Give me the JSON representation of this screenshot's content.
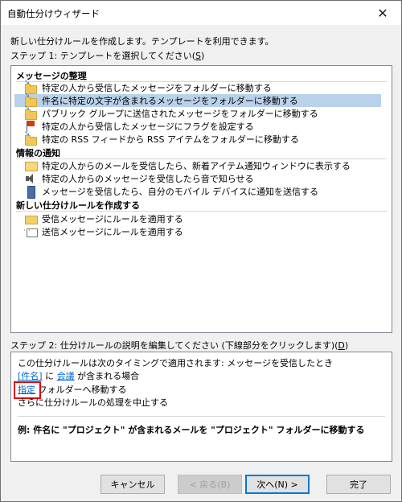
{
  "window": {
    "title": "自動仕分けウィザード",
    "close_glyph": "✕"
  },
  "intro_text": "新しい仕分けルールを作成します。テンプレートを利用できます。",
  "step1": {
    "label_prefix": "ステップ 1: テンプレートを選択してください(",
    "label_key": "S",
    "label_suffix": ")"
  },
  "groups": [
    {
      "header": "メッセージの整理",
      "items": [
        {
          "label": "特定の人から受信したメッセージをフォルダーに移動する",
          "icon": "folder-move-icon",
          "selected": false
        },
        {
          "label": "件名に特定の文字が含まれるメッセージをフォルダーに移動する",
          "icon": "folder-move-icon",
          "selected": true
        },
        {
          "label": "パブリック グループに送信されたメッセージをフォルダーに移動する",
          "icon": "folder-move-icon",
          "selected": false
        },
        {
          "label": "特定の人から受信したメッセージにフラグを設定する",
          "icon": "flag-icon",
          "selected": false
        },
        {
          "label": "特定の RSS フィードから RSS アイテムをフォルダーに移動する",
          "icon": "folder-move-icon",
          "selected": false
        }
      ]
    },
    {
      "header": "情報の通知",
      "items": [
        {
          "label": "特定の人からのメールを受信したら、新着アイテム通知ウィンドウに表示する",
          "icon": "new-mail-alert-icon",
          "selected": false
        },
        {
          "label": "特定の人からのメッセージを受信したら音で知らせる",
          "icon": "speaker-icon",
          "selected": false
        },
        {
          "label": "メッセージを受信したら、自分のモバイル デバイスに通知を送信する",
          "icon": "mobile-device-icon",
          "selected": false
        }
      ]
    },
    {
      "header": "新しい仕分けルールを作成する",
      "items": [
        {
          "label": "受信メッセージにルールを適用する",
          "icon": "envelope-icon",
          "selected": false
        },
        {
          "label": "送信メッセージにルールを適用する",
          "icon": "outbox-icon",
          "selected": false
        }
      ]
    }
  ],
  "step2": {
    "label_prefix": "ステップ 2: 仕分けルールの説明を編集してください (下線部分をクリックします)(",
    "label_key": "D",
    "label_suffix": ")"
  },
  "description": {
    "line1": "この仕分けルールは次のタイミングで適用されます: メッセージを受信したとき",
    "line2_link1": "[件名]",
    "line2_mid": " に ",
    "line2_link2": "会議",
    "line2_tail": " が含まれる場合",
    "line3_link": "指定",
    "line3_tail": " フォルダーへ移動する",
    "line4": "さらに仕分けルールの処理を中止する",
    "example": "例: 件名に \"プロジェクト\" が含まれるメールを \"プロジェクト\" フォルダーに移動する"
  },
  "buttons": {
    "cancel": "キャンセル",
    "back": "< 戻る(B)",
    "next": "次へ(N) >",
    "finish": "完了"
  }
}
